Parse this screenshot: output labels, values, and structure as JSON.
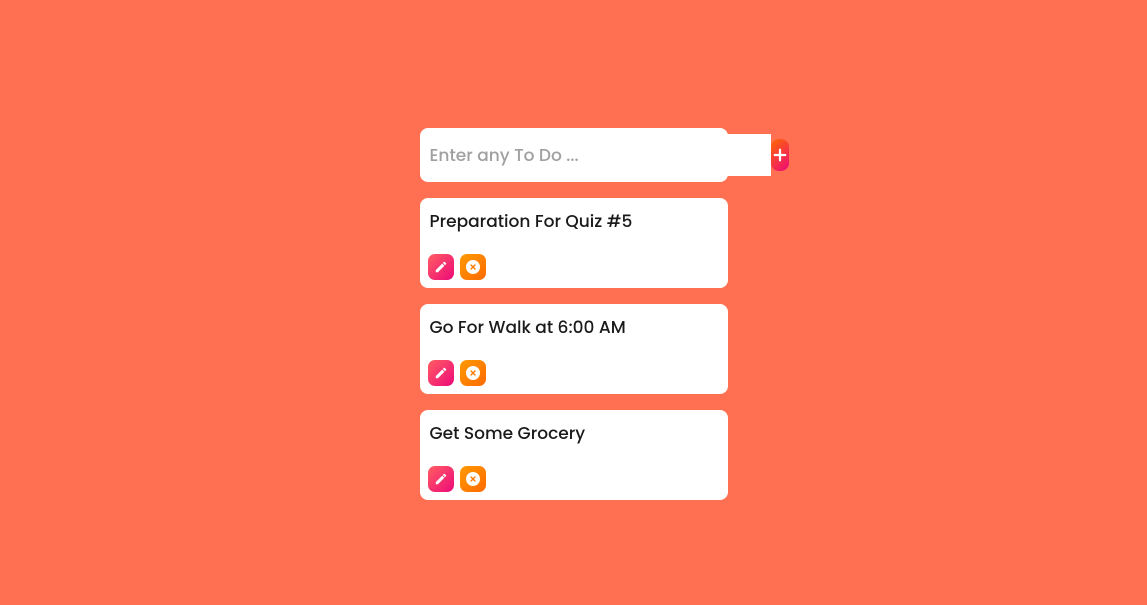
{
  "input": {
    "placeholder": "Enter any To Do ...",
    "value": ""
  },
  "todos": [
    {
      "text": "Preparation For Quiz #5"
    },
    {
      "text": "Go For Walk at 6:00 AM"
    },
    {
      "text": "Get Some Grocery"
    }
  ],
  "icons": {
    "add": "plus-icon",
    "edit": "pencil-icon",
    "delete": "close-circle-icon"
  },
  "colors": {
    "background": "#ff6f51",
    "card": "#ffffff",
    "gradient_add": [
      "#ff6a00",
      "#ee0979"
    ],
    "gradient_edit": [
      "#ff5e62",
      "#ee0979"
    ],
    "gradient_delete": [
      "#ff9a00",
      "#ff6a00"
    ]
  }
}
